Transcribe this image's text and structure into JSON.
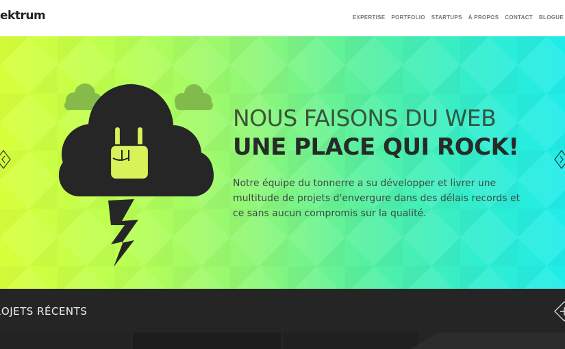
{
  "header": {
    "logo": "ektrum",
    "nav": [
      "EXPERTISE",
      "PORTFOLIO",
      "STARTUPS",
      "À PROPOS",
      "CONTACT",
      "BLOGUE"
    ]
  },
  "hero": {
    "title_line1": "NOUS FAISONS DU WEB",
    "title_line2": "UNE PLACE QUI ROCK!",
    "description": "Notre équipe du tonnerre a su développer et livrer une multitude de projets d'envergure dans des délais records et ce sans aucun compromis sur la qualité.",
    "icons": [
      "rock-hand-cloud-icon",
      "lightning-bolt-icon",
      "chevron-left-icon",
      "chevron-right-icon"
    ]
  },
  "projects": {
    "title": "ROJETS RÉCENTS",
    "icons": [
      "plus-icon"
    ]
  },
  "colors": {
    "gradient_left": "#d8ff3a",
    "gradient_mid": "#8ff777",
    "gradient_right": "#20ecea",
    "dark": "#252525",
    "text_dark": "#262b28"
  }
}
